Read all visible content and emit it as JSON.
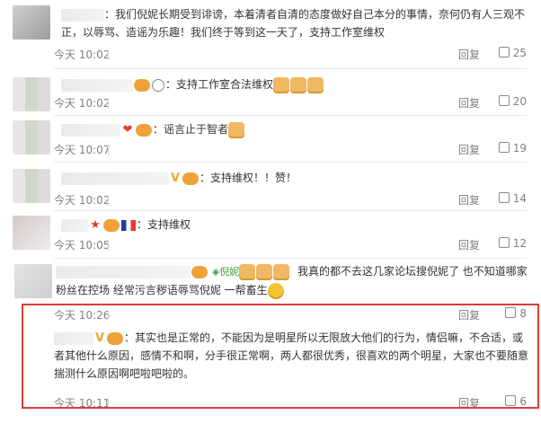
{
  "comments": [
    {
      "text": "：我们倪妮长期受到诽谤，本着清者自清的态度做好自己本分的事情，奈何仍有人三观不正，以辱骂、造谣为乐趣！我们终于等到这一天了，支持工作室维权",
      "time": "今天 10:02",
      "reply": "回复",
      "likes": "25"
    },
    {
      "text": "：支持工作室合法维权",
      "time": "今天 10:02",
      "reply": "回复",
      "likes": "20"
    },
    {
      "text": "：谣言止于智者",
      "time": "今天 10:07",
      "reply": "回复",
      "likes": "19"
    },
    {
      "text": "：支持维权！！赞！",
      "time": "今天 10:02",
      "reply": "回复",
      "likes": "14"
    },
    {
      "text": "：支持维权",
      "time": "今天 10:05",
      "reply": "回复",
      "likes": "12"
    },
    {
      "repost": "倪妮",
      "text_a": "我真的都不去这几家论坛搜倪妮了 也不知道哪家粉丝在控场 经常污言秽语辱骂倪妮 一帮畜生",
      "time": "今天 10:26",
      "reply": "回复",
      "likes": "8"
    },
    {
      "text": "：其实也是正常的，不能因为是明星所以无限放大他们的行为，情侣嘛，不合适，或者其他什么原因，感情不和啊，分手很正常啊，两人都很优秀，很喜欢的两个明星，大家也不要随意揣测什么原因啊吧啦吧啦的。",
      "time": "今天 10:11",
      "reply": "回复",
      "likes": "6"
    }
  ],
  "colors": {
    "highlight": "#e03a3a",
    "meta": "#808080",
    "text": "#333333"
  }
}
